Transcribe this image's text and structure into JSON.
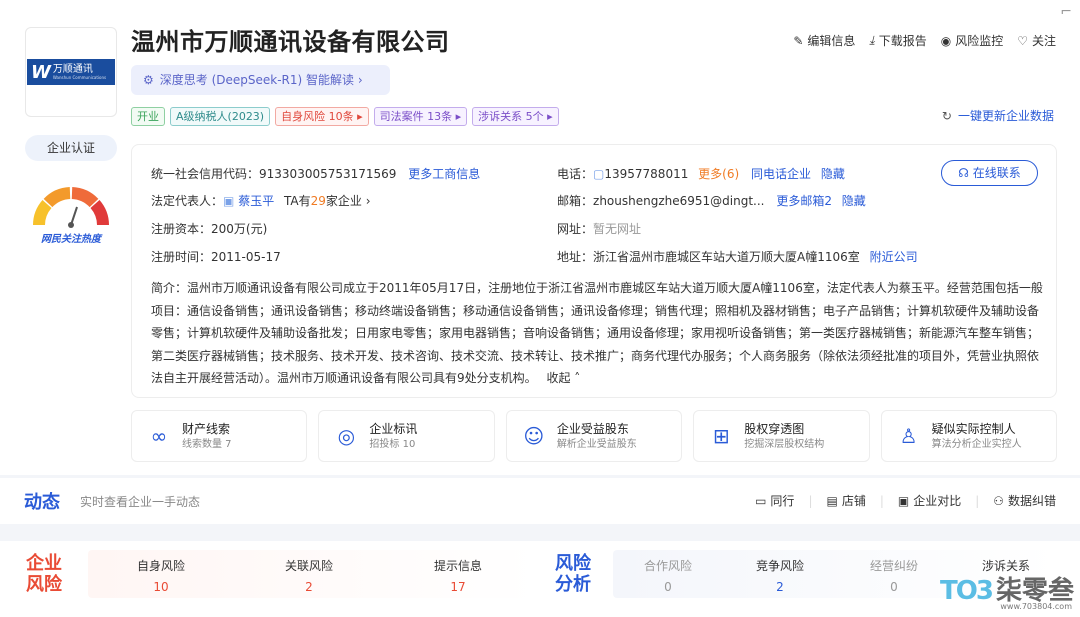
{
  "company": {
    "name": "温州市万顺通讯设备有限公司",
    "logo_brand": "万顺通讯",
    "logo_sub": "Wanshun Communications",
    "cert_label": "企业认证",
    "heat_label": "网民关注热度"
  },
  "ai": {
    "label": "深度思考 (DeepSeek-R1) 智能解读 ›"
  },
  "top_actions": [
    "编辑信息",
    "下载报告",
    "风险监控",
    "关注"
  ],
  "tags": [
    {
      "label": "开业"
    },
    {
      "label": "A级纳税人(2023)"
    },
    {
      "label": "自身风险 10条 ▸"
    },
    {
      "label": "司法案件 13条 ▸"
    },
    {
      "label": "涉诉关系 5个 ▸"
    }
  ],
  "refresh_label": "一键更新企业数据",
  "info": {
    "credit_code_label": "统一社会信用代码：",
    "credit_code": "913303005753171569",
    "more_biz": "更多工商信息",
    "phone_label": "电话：",
    "phone": "13957788011",
    "phone_more": "更多(6)",
    "same_phone": "同电话企业",
    "hide1": "隐藏",
    "legal_label": "法定代表人：",
    "legal_name": "蔡玉平",
    "legal_ta_pre": "TA有",
    "legal_ta_count": "29",
    "legal_ta_post": "家企业 ›",
    "email_label": "邮箱：",
    "email": "zhoushengzhe6951@dingt...",
    "email_more": "更多邮箱2",
    "hide2": "隐藏",
    "capital_label": "注册资本：",
    "capital": "200万(元)",
    "website_label": "网址：",
    "website": "暂无网址",
    "date_label": "注册时间：",
    "date": "2011-05-17",
    "address_label": "地址：",
    "address": "浙江省温州市鹿城区车站大道万顺大厦A幢1106室",
    "nearby": "附近公司",
    "contact_btn": "在线联系",
    "intro": "简介：温州市万顺通讯设备有限公司成立于2011年05月17日，注册地位于浙江省温州市鹿城区车站大道万顺大厦A幢1106室，法定代表人为蔡玉平。经营范围包括一般项目：通信设备销售；通讯设备销售；移动终端设备销售；移动通信设备销售；通讯设备修理；销售代理；照相机及器材销售；电子产品销售；计算机软硬件及辅助设备零售；计算机软硬件及辅助设备批发；日用家电零售；家用电器销售；音响设备销售；通用设备修理；家用视听设备销售；第一类医疗器械销售；新能源汽车整车销售；第二类医疗器械销售；技术服务、技术开发、技术咨询、技术交流、技术转让、技术推广；商务代理代办服务；个人商务服务（除依法须经批准的项目外，凭营业执照依法自主开展经营活动）。温州市万顺通讯设备有限公司具有9处分支机构。",
    "collapse": "收起 ˄"
  },
  "features": [
    {
      "title": "财产线索",
      "sub": "线索数量 7",
      "icon": "clue-icon"
    },
    {
      "title": "企业标讯",
      "sub": "招投标 10",
      "icon": "bid-icon"
    },
    {
      "title": "企业受益股东",
      "sub": "解析企业受益股东",
      "icon": "shareholder-icon"
    },
    {
      "title": "股权穿透图",
      "sub": "挖掘深层股权结构",
      "icon": "equity-icon"
    },
    {
      "title": "疑似实际控制人",
      "sub": "算法分析企业实控人",
      "icon": "controller-icon"
    }
  ],
  "dynamic": {
    "title": "动态",
    "sub": "实时查看企业一手动态",
    "actions": [
      "同行",
      "店铺",
      "企业对比",
      "数据纠错"
    ]
  },
  "risk": {
    "title_left_1": "企业",
    "title_left_2": "风险",
    "title_right_1": "风险",
    "title_right_2": "分析",
    "left": [
      {
        "label": "自身风险",
        "value": "10"
      },
      {
        "label": "关联风险",
        "value": "2"
      },
      {
        "label": "提示信息",
        "value": "17"
      }
    ],
    "right": [
      {
        "label": "合作风险",
        "value": "0"
      },
      {
        "label": "竞争风险",
        "value": "2"
      },
      {
        "label": "经营纠纷",
        "value": "0"
      },
      {
        "label": "涉诉关系",
        "value": ""
      }
    ]
  },
  "watermark": {
    "logo": "TO3",
    "cn": "柒零叁",
    "url": "www.703804.com"
  },
  "colors": {
    "accent": "#2a5bd7",
    "risk_red": "#e94b35"
  }
}
